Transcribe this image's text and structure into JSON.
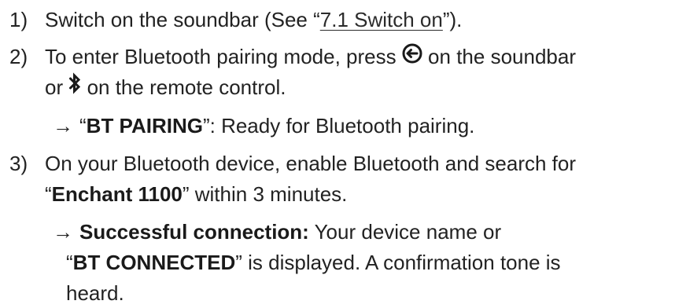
{
  "steps": [
    {
      "number": "1)",
      "text_before": "Switch on the soundbar (See “",
      "link_text": "7.1 Switch on",
      "text_after": "”)."
    },
    {
      "number": "2)",
      "line1_before": "To enter Bluetooth pairing mode, press ",
      "line1_after": " on the soundbar",
      "line2_before": "or ",
      "line2_after": " on the remote control.",
      "result": {
        "quote_open": "“",
        "bold": "BT PAIRING",
        "rest": "”: Ready for Bluetooth pairing."
      }
    },
    {
      "number": "3)",
      "line1": "On your Bluetooth device, enable Bluetooth and search for",
      "line2_quote_open": "“",
      "line2_bold": "Enchant 1100",
      "line2_rest": "” within 3 minutes.",
      "result": {
        "bold_label": "Successful connection:",
        "line1_rest": " Your device name or",
        "line2_quote_open": "“",
        "line2_bold": "BT CONNECTED",
        "line2_rest": "” is displayed. A confirmation tone is",
        "line3": "heard."
      }
    }
  ],
  "icons": {
    "source": "source-input-icon",
    "bluetooth": "bluetooth-icon",
    "arrow": "result-arrow-icon"
  },
  "colors": {
    "text": "#222222"
  }
}
